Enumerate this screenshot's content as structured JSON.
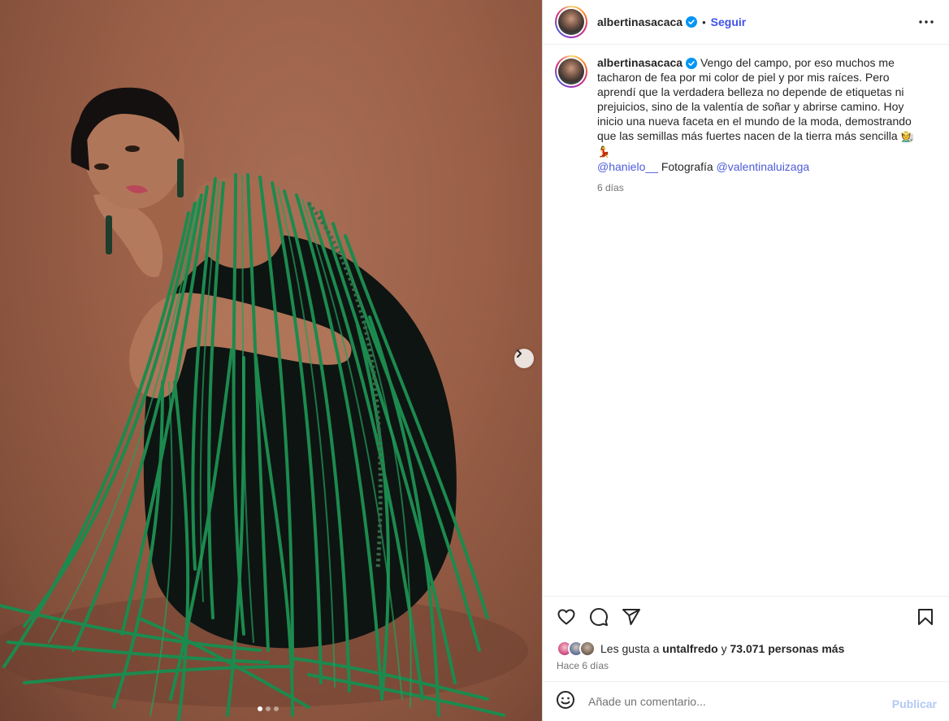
{
  "media": {
    "carousel_position": 1,
    "carousel_count": 3,
    "next_icon": "chevron-right-icon"
  },
  "post_header": {
    "username": "albertinasacaca",
    "verified_icon": "verified-badge-icon",
    "separator": "•",
    "follow_label": "Seguir",
    "more_icon": "more-options-icon"
  },
  "caption": {
    "username": "albertinasacaca",
    "text": "Vengo del campo, por eso muchos me tacharon de fea por mi color de piel y por mis raíces. Pero aprendí que la verdadera belleza no depende de etiquetas ni prejuicios, sino de la valentía de soñar y abrirse camino. Hoy inicio una nueva faceta en el mundo de la moda, demostrando que las semillas más fuertes nacen de la tierra más sencilla",
    "emoji_1": "🧑‍🌾",
    "emoji_2": "💃",
    "mention_1": "@hanielo__",
    "credit_label": "Fotografía",
    "mention_2": "@valentinaluizaga",
    "time": "6 días"
  },
  "actions": {
    "like_icon": "heart-icon",
    "comment_icon": "comment-icon",
    "share_icon": "share-icon",
    "save_icon": "bookmark-icon"
  },
  "likes": {
    "prefix": "Les gusta a",
    "user": "untalfredo",
    "conjunction": "y",
    "others": "73.071 personas más"
  },
  "posted": "Hace 6 días",
  "comment": {
    "emoji_icon": "smiley-icon",
    "placeholder": "Añade un comentario...",
    "publish_label": "Publicar"
  },
  "colors": {
    "link": "#4152e8",
    "publish_disabled": "#b3c8f5",
    "dress_green": "#1c8a4e",
    "backdrop": "#9a5f47"
  }
}
